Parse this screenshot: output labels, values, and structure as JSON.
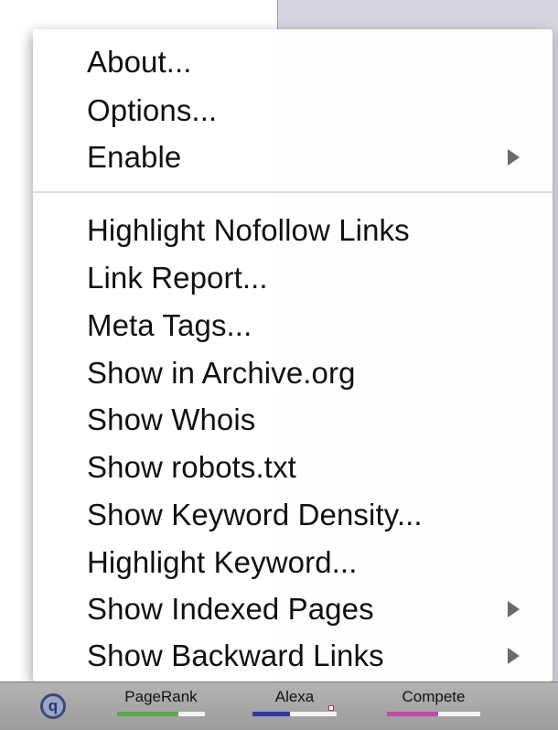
{
  "menu": {
    "group1": [
      {
        "label": "About...",
        "has_submenu": false
      },
      {
        "label": "Options...",
        "has_submenu": false
      },
      {
        "label": "Enable",
        "has_submenu": true
      }
    ],
    "group2": [
      {
        "label": "Highlight Nofollow Links",
        "has_submenu": false
      },
      {
        "label": "Link Report...",
        "has_submenu": false
      },
      {
        "label": "Meta Tags...",
        "has_submenu": false
      },
      {
        "label": "Show in Archive.org",
        "has_submenu": false
      },
      {
        "label": "Show Whois",
        "has_submenu": false
      },
      {
        "label": "Show robots.txt",
        "has_submenu": false
      },
      {
        "label": "Show Keyword Density...",
        "has_submenu": false
      },
      {
        "label": "Highlight Keyword...",
        "has_submenu": false
      },
      {
        "label": "Show Indexed Pages",
        "has_submenu": true
      },
      {
        "label": "Show Backward Links",
        "has_submenu": true
      }
    ]
  },
  "statusbar": {
    "logo_icon": "seoquake-logo-icon",
    "metrics": [
      {
        "label": "PageRank",
        "color": "#5aa84a",
        "fill": 0.7
      },
      {
        "label": "Alexa",
        "color": "#2a3aa8",
        "fill": 0.45
      },
      {
        "label": "Compete",
        "color": "#c24aa8",
        "fill": 0.55
      }
    ]
  }
}
